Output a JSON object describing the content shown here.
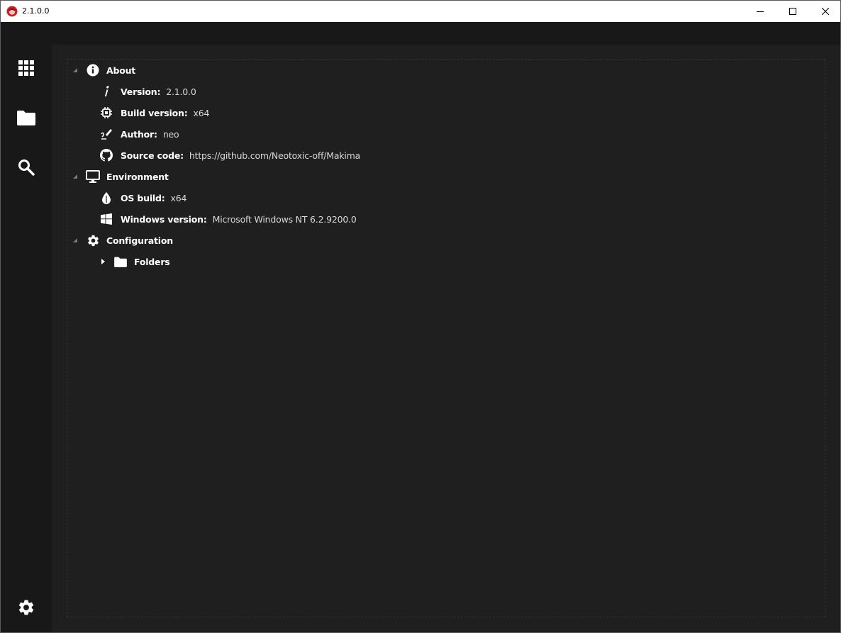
{
  "window": {
    "title": "2.1.0.0"
  },
  "sidebar": {
    "items": [
      {
        "icon": "apps-grid-icon"
      },
      {
        "icon": "folder-icon"
      },
      {
        "icon": "search-icon"
      }
    ],
    "bottom": {
      "icon": "gear-icon"
    }
  },
  "tree": {
    "about": {
      "label": "About",
      "version": {
        "label": "Version:",
        "value": "2.1.0.0"
      },
      "build": {
        "label": "Build version:",
        "value": "x64"
      },
      "author": {
        "label": "Author:",
        "value": "neo"
      },
      "source": {
        "label": "Source code:",
        "value": "https://github.com/Neotoxic-off/Makima"
      }
    },
    "environment": {
      "label": "Environment",
      "os_build": {
        "label": "OS build:",
        "value": "x64"
      },
      "windows_version": {
        "label": "Windows version:",
        "value": "Microsoft Windows NT 6.2.9200.0"
      }
    },
    "configuration": {
      "label": "Configuration",
      "folders": {
        "label": "Folders"
      }
    }
  }
}
